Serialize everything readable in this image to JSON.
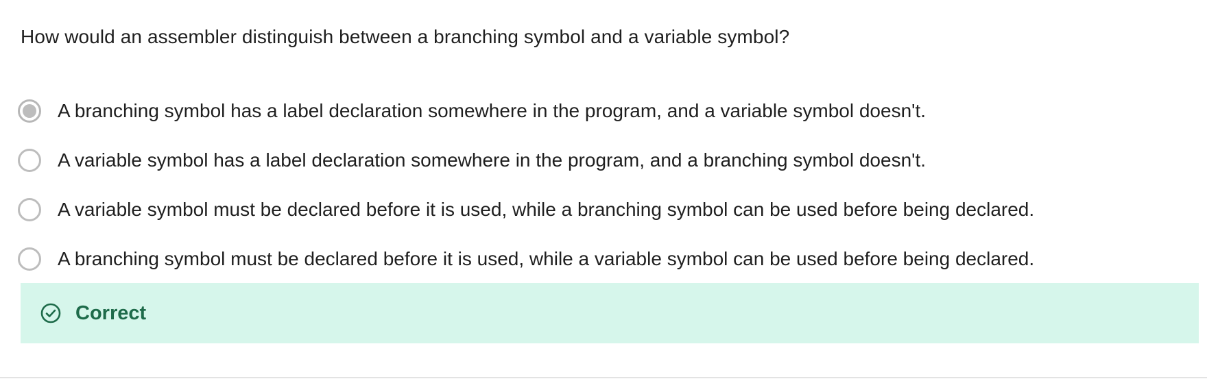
{
  "question": {
    "text": "How would an assembler distinguish between a branching symbol and a variable symbol?"
  },
  "options": [
    {
      "label": "A branching symbol has a label declaration somewhere in the program, and a variable symbol doesn't.",
      "selected": true
    },
    {
      "label": "A variable symbol has a label declaration somewhere in the program, and a branching symbol doesn't.",
      "selected": false
    },
    {
      "label": "A variable symbol must be declared before it is used, while a branching symbol can be used before being declared.",
      "selected": false
    },
    {
      "label": "A branching symbol must be declared before it is used, while a variable symbol can be used before being declared.",
      "selected": false
    }
  ],
  "feedback": {
    "text": "Correct",
    "icon": "check-circle-icon",
    "background_color": "#d6f6eb",
    "text_color": "#1e6b4a"
  }
}
